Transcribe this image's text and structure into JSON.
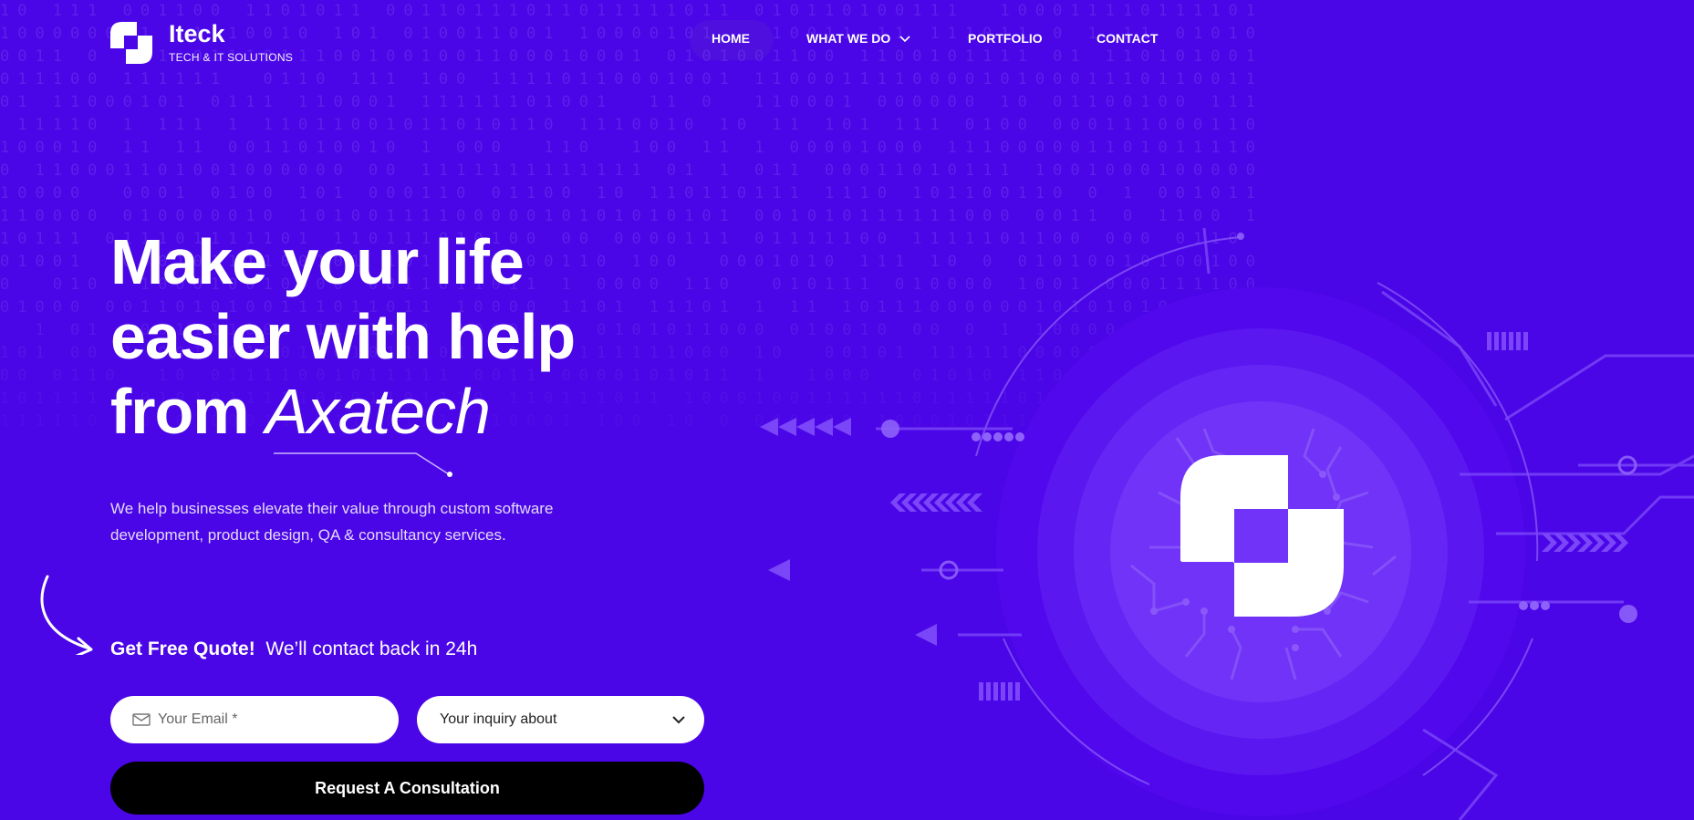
{
  "brand": {
    "name": "Iteck",
    "tagline": "TECH & IT SOLUTIONS",
    "logo_icon": "iteck-logo-icon"
  },
  "nav": {
    "items": [
      {
        "label": "HOME",
        "active": true
      },
      {
        "label": "WHAT WE DO",
        "has_dropdown": true,
        "icon": "chevron-down-icon"
      },
      {
        "label": "PORTFOLIO"
      },
      {
        "label": "CONTACT"
      }
    ]
  },
  "hero": {
    "title_line1": "Make your life",
    "title_line2": "easier with help",
    "title_line3_prefix": "from",
    "title_accent": "Axatech",
    "description": "We help businesses elevate their value through custom software development, product design, QA & consultancy services."
  },
  "quote": {
    "strong": "Get Free Quote!",
    "text": "We’ll contact back in 24h"
  },
  "form": {
    "email_placeholder": "Your Email *",
    "email_value": "",
    "email_icon": "envelope-icon",
    "inquiry_value": "Your inquiry about",
    "inquiry_icon": "chevron-down-icon",
    "submit_label": "Request A Consultation"
  },
  "colors": {
    "background": "#4a06e6",
    "button": "#000000",
    "field": "#ffffff",
    "text": "#ffffff"
  }
}
